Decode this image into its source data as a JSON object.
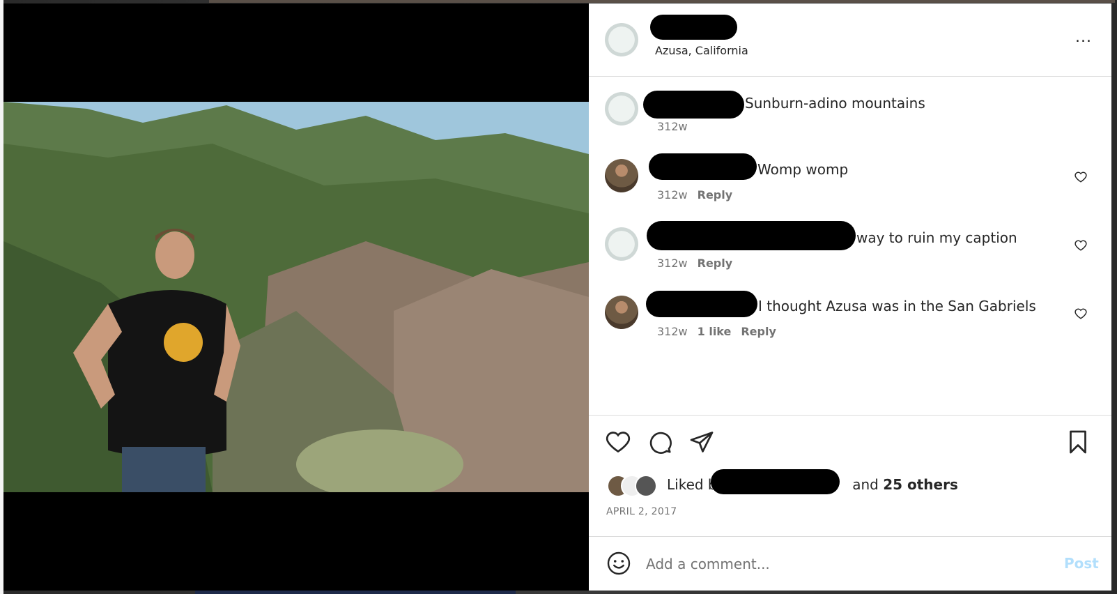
{
  "post": {
    "location": "Azusa, California",
    "more_label": "...",
    "caption": {
      "text": "Sunburn-adino mountains",
      "time": "312w"
    },
    "comments": [
      {
        "text": "Womp womp",
        "time": "312w",
        "likes": "",
        "reply_label": "Reply"
      },
      {
        "text": "way to ruin my caption",
        "time": "312w",
        "likes": "",
        "reply_label": "Reply"
      },
      {
        "text": "I thought Azusa was in the San Gabriels",
        "time": "312w",
        "likes": "1 like",
        "reply_label": "Reply"
      }
    ],
    "liked_prefix": "Liked by",
    "liked_suffix_and": "and",
    "liked_others": "25 others",
    "date": "APRIL 2, 2017"
  },
  "composer": {
    "placeholder": "Add a comment...",
    "post_label": "Post"
  },
  "icons": {
    "emoji": "smiley-icon",
    "like": "heart-icon",
    "comment": "comment-bubble-icon",
    "share": "paper-plane-icon",
    "save": "bookmark-icon",
    "more": "ellipsis-icon"
  },
  "colors": {
    "text": "#262626",
    "muted": "#737373",
    "post_button": "#b2dffc",
    "divider": "#dbdbdb"
  }
}
